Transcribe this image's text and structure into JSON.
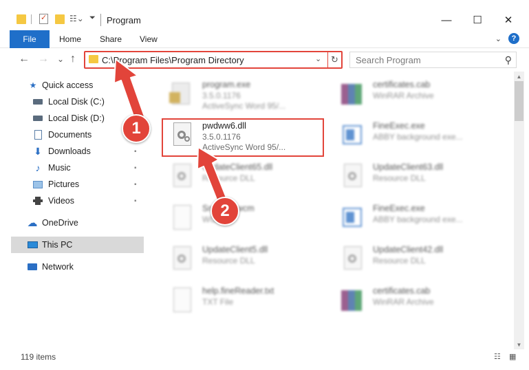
{
  "window": {
    "title": "Program",
    "minimize": "—",
    "maximize": "☐",
    "close": "✕"
  },
  "ribbon": {
    "tabs": [
      "File",
      "Home",
      "Share",
      "View"
    ],
    "expand": "⌄",
    "help": "?"
  },
  "nav": {
    "back": "←",
    "forward": "→",
    "recent": "⌄",
    "up": "↑"
  },
  "address": {
    "path": "C:\\Program Files\\Program Directory",
    "chevron": "⌄",
    "refresh": "↻"
  },
  "search": {
    "placeholder": "Search Program",
    "icon": "⚲"
  },
  "sidebar": {
    "items": [
      {
        "label": "Quick access",
        "icon": "star-icon",
        "glyph": "★",
        "color": "#2b6fc4",
        "pinned": false
      },
      {
        "label": "Local Disk (C:)",
        "icon": "drive-icon",
        "glyph": "▬",
        "color": "#5a6b7d",
        "pinned": true
      },
      {
        "label": "Local Disk (D:)",
        "icon": "drive-icon",
        "glyph": "▬",
        "color": "#5a6b7d",
        "pinned": false
      },
      {
        "label": "Documents",
        "icon": "document-icon",
        "glyph": "▤",
        "color": "#5b7fa8",
        "pinned": true
      },
      {
        "label": "Downloads",
        "icon": "download-icon",
        "glyph": "⬇",
        "color": "#2b6fc4",
        "pinned": true
      },
      {
        "label": "Music",
        "icon": "music-icon",
        "glyph": "♪",
        "color": "#2b6fc4",
        "pinned": true
      },
      {
        "label": "Pictures",
        "icon": "pictures-icon",
        "glyph": "▣",
        "color": "#5b8fc8",
        "pinned": true
      },
      {
        "label": "Videos",
        "icon": "video-icon",
        "glyph": "▥",
        "color": "#444444",
        "pinned": true
      },
      {
        "label": "OneDrive",
        "icon": "cloud-icon",
        "glyph": "☁",
        "color": "#2b6fc4",
        "pinned": false
      },
      {
        "label": "This PC",
        "icon": "computer-icon",
        "glyph": "▭",
        "color": "#2b8ad8",
        "pinned": false
      },
      {
        "label": "Network",
        "icon": "network-icon",
        "glyph": "⊞",
        "color": "#2b6fc4",
        "pinned": false
      }
    ],
    "pin_glyph": "📌"
  },
  "files": [
    {
      "name": "program.exe",
      "line1": "3.5.0.1176",
      "line2": "ActiveSync Word 95/...",
      "icon": "exe-icon"
    },
    {
      "name": "certificates.cab",
      "line1": "WinRAR Archive",
      "line2": "",
      "icon": "archive-icon"
    },
    {
      "name": "pwdww6.dll",
      "line1": "3.5.0.1176",
      "line2": "ActiveSync Word 95/...",
      "icon": "dll-icon"
    },
    {
      "name": "FineExec.exe",
      "line1": "ABBY background exe...",
      "line2": "",
      "icon": "app-icon"
    },
    {
      "name": "UpdateClient65.dll",
      "line1": "Resource DLL",
      "line2": "",
      "icon": "dll-icon"
    },
    {
      "name": "UpdateClient63.dll",
      "line1": "Resource DLL",
      "line2": "",
      "icon": "dll-icon"
    },
    {
      "name": "Snd.....6.wcm",
      "line1": "WCM...",
      "line2": "",
      "icon": "blank-file-icon"
    },
    {
      "name": "FineExec.exe",
      "line1": "ABBY background exe...",
      "line2": "",
      "icon": "app-icon"
    },
    {
      "name": "UpdateClient5.dll",
      "line1": "Resource DLL",
      "line2": "",
      "icon": "dll-icon"
    },
    {
      "name": "UpdateClient42.dll",
      "line1": "Resource DLL",
      "line2": "",
      "icon": "dll-icon"
    },
    {
      "name": "help.fineReader.txt",
      "line1": "TXT File",
      "line2": "",
      "icon": "blank-file-icon"
    },
    {
      "name": "certificates.cab",
      "line1": "WinRAR Archive",
      "line2": "",
      "icon": "archive-icon"
    }
  ],
  "status": {
    "count": "119 items",
    "details_view": "☷",
    "icons_view": "▦"
  },
  "callouts": {
    "one": "1",
    "two": "2"
  },
  "colors": {
    "accent": "#1f6fc9",
    "highlight": "#e2443a",
    "selected": "#d9d9d9"
  }
}
